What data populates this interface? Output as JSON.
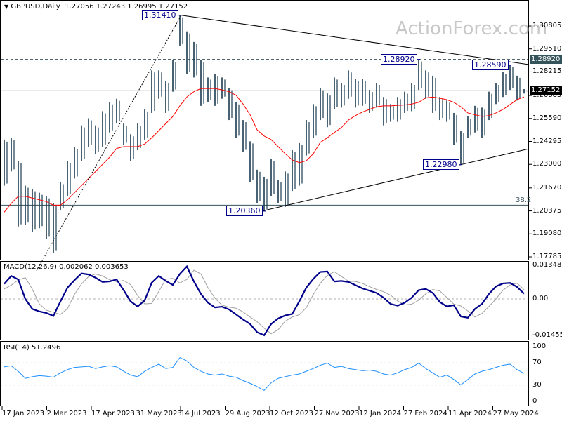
{
  "header": {
    "symbol": "GBPUSD,Daily",
    "ohlc": "1.27056 1.27243 1.26995 1.27152"
  },
  "watermark": "ActionForex.com",
  "colors": {
    "bars": "#1b3b50",
    "ma": "#ff0000",
    "macd": "#00008b",
    "signal": "#a0a0a0",
    "rsi": "#1e90ff",
    "current_tag": "#000000",
    "level_tag": "#35535a"
  },
  "chart_data": [
    {
      "type": "ohlc-bar",
      "timeframe": "Daily",
      "ylim": [
        1.17785,
        1.3141
      ],
      "y_ticks": [
        "1.30805",
        "1.29510",
        "1.28215",
        "1.26885",
        "1.25590",
        "1.24295",
        "1.23000",
        "1.21670",
        "1.20375",
        "1.19080",
        "1.17785"
      ],
      "x_ticks": [
        "17 Jan 2023",
        "2 Mar 2023",
        "17 Apr 2023",
        "31 May 2023",
        "14 Jul 2023",
        "29 Aug 2023",
        "12 Oct 2023",
        "27 Nov 2023",
        "12 Jan 2024",
        "27 Feb 2024",
        "11 Apr 2024",
        "27 May 2024"
      ],
      "bars_high_low": [
        [
          1.244,
          1.218
        ],
        [
          1.245,
          1.226
        ],
        [
          1.232,
          1.195
        ],
        [
          1.218,
          1.196
        ],
        [
          1.216,
          1.192
        ],
        [
          1.214,
          1.194
        ],
        [
          1.212,
          1.188
        ],
        [
          1.208,
          1.18
        ],
        [
          1.22,
          1.204
        ],
        [
          1.232,
          1.212
        ],
        [
          1.24,
          1.222
        ],
        [
          1.252,
          1.232
        ],
        [
          1.256,
          1.24
        ],
        [
          1.252,
          1.236
        ],
        [
          1.26,
          1.24
        ],
        [
          1.265,
          1.248
        ],
        [
          1.267,
          1.253
        ],
        [
          1.253,
          1.241
        ],
        [
          1.247,
          1.232
        ],
        [
          1.253,
          1.238
        ],
        [
          1.261,
          1.244
        ],
        [
          1.283,
          1.259
        ],
        [
          1.283,
          1.267
        ],
        [
          1.277,
          1.259
        ],
        [
          1.289,
          1.271
        ],
        [
          1.3141,
          1.297
        ],
        [
          1.305,
          1.281
        ],
        [
          1.299,
          1.279
        ],
        [
          1.289,
          1.263
        ],
        [
          1.279,
          1.265
        ],
        [
          1.281,
          1.263
        ],
        [
          1.279,
          1.267
        ],
        [
          1.273,
          1.255
        ],
        [
          1.265,
          1.245
        ],
        [
          1.255,
          1.237
        ],
        [
          1.243,
          1.22
        ],
        [
          1.227,
          1.208
        ],
        [
          1.223,
          1.2036
        ],
        [
          1.233,
          1.212
        ],
        [
          1.221,
          1.208
        ],
        [
          1.226,
          1.206
        ],
        [
          1.238,
          1.215
        ],
        [
          1.242,
          1.218
        ],
        [
          1.255,
          1.235
        ],
        [
          1.264,
          1.245
        ],
        [
          1.273,
          1.255
        ],
        [
          1.27,
          1.251
        ],
        [
          1.279,
          1.261
        ],
        [
          1.276,
          1.262
        ],
        [
          1.283,
          1.267
        ],
        [
          1.278,
          1.262
        ],
        [
          1.278,
          1.263
        ],
        [
          1.272,
          1.259
        ],
        [
          1.276,
          1.262
        ],
        [
          1.268,
          1.252
        ],
        [
          1.264,
          1.254
        ],
        [
          1.268,
          1.254
        ],
        [
          1.271,
          1.259
        ],
        [
          1.276,
          1.26
        ],
        [
          1.2892,
          1.272
        ],
        [
          1.283,
          1.267
        ],
        [
          1.28,
          1.259
        ],
        [
          1.268,
          1.255
        ],
        [
          1.266,
          1.254
        ],
        [
          1.259,
          1.241
        ],
        [
          1.249,
          1.2298
        ],
        [
          1.257,
          1.245
        ],
        [
          1.263,
          1.248
        ],
        [
          1.262,
          1.245
        ],
        [
          1.271,
          1.255
        ],
        [
          1.276,
          1.264
        ],
        [
          1.282,
          1.268
        ],
        [
          1.2859,
          1.272
        ],
        [
          1.28,
          1.266
        ],
        [
          1.27243,
          1.26995
        ]
      ],
      "moving_average": [
        1.203,
        1.208,
        1.212,
        1.212,
        1.211,
        1.21,
        1.209,
        1.207,
        1.207,
        1.21,
        1.214,
        1.218,
        1.222,
        1.226,
        1.23,
        1.234,
        1.239,
        1.24,
        1.24,
        1.24,
        1.2415,
        1.245,
        1.249,
        1.253,
        1.257,
        1.263,
        1.268,
        1.271,
        1.2728,
        1.2728,
        1.2728,
        1.272,
        1.271,
        1.269,
        1.264,
        1.258,
        1.2495,
        1.246,
        1.244,
        1.24,
        1.236,
        1.2325,
        1.231,
        1.232,
        1.236,
        1.2424,
        1.245,
        1.248,
        1.2507,
        1.255,
        1.2575,
        1.2595,
        1.261,
        1.2625,
        1.263,
        1.263,
        1.2633,
        1.2635,
        1.264,
        1.265,
        1.2675,
        1.268,
        1.2673,
        1.2665,
        1.265,
        1.2625,
        1.259,
        1.258,
        1.257,
        1.2575,
        1.259,
        1.261,
        1.2637,
        1.2665,
        1.268
      ],
      "swing_labels": [
        {
          "text": "1.31410",
          "price": 1.3141,
          "bar": 25
        },
        {
          "text": "1.28920",
          "price": 1.2892,
          "bar": 59
        },
        {
          "text": "1.28590",
          "price": 1.2859,
          "bar": 72
        },
        {
          "text": "1.22980",
          "price": 1.2298,
          "bar": 65
        },
        {
          "text": "1.20360",
          "price": 1.2036,
          "bar": 37
        }
      ],
      "trendlines": [
        {
          "style": "solid",
          "from": {
            "bar": 25.2,
            "price": 1.3141
          },
          "to": {
            "bar": 74.7,
            "price": 1.2863
          }
        },
        {
          "style": "solid",
          "from": {
            "bar": 36.6,
            "price": 1.2036
          },
          "to": {
            "bar": 74.7,
            "price": 1.2388
          }
        },
        {
          "style": "dotted",
          "from": {
            "bar": 4.6,
            "price": 1.17
          },
          "to": {
            "bar": 25.2,
            "price": 1.3141
          }
        }
      ],
      "horizontal_lines": [
        {
          "style": "dashed",
          "price": 1.2892,
          "tag": "1.28920"
        },
        {
          "style": "current",
          "price": 1.27152,
          "tag": "1.27152"
        },
        {
          "style": "fib",
          "price": 1.207,
          "label": "38.2"
        }
      ]
    },
    {
      "type": "line",
      "title": "MACD(12,26,9) 0.002062 0.003653",
      "y_ticks": [
        "0.013489",
        "0.00",
        "-0.014554"
      ],
      "ylim": [
        -0.014554,
        0.013489
      ],
      "macd": [
        0.006,
        0.0092,
        0.0078,
        0.0,
        -0.004,
        -0.005,
        -0.0056,
        -0.0068,
        -0.001,
        0.0045,
        0.0075,
        0.0102,
        0.0098,
        0.0085,
        0.0068,
        0.007,
        0.0078,
        0.0035,
        -0.001,
        -0.003,
        -0.0006,
        0.0065,
        0.0092,
        0.0072,
        0.0056,
        0.01,
        0.013,
        0.007,
        0.002,
        -0.0015,
        -0.0034,
        -0.0031,
        -0.0042,
        -0.0062,
        -0.0082,
        -0.01,
        -0.0133,
        -0.0145,
        -0.01,
        -0.0078,
        -0.0066,
        -0.006,
        -0.001,
        0.0045,
        0.008,
        0.0108,
        0.011,
        0.007,
        0.0072,
        0.0068,
        0.0055,
        0.0042,
        0.0033,
        0.0024,
        0.0005,
        -0.002,
        -0.0027,
        -0.0015,
        0.0005,
        0.0035,
        0.004,
        0.0024,
        -0.0012,
        -0.003,
        -0.0025,
        -0.007,
        -0.0075,
        -0.004,
        -0.002,
        0.002,
        0.005,
        0.0062,
        0.0064,
        0.0048,
        0.0021
      ],
      "signal": [
        0.004,
        0.0055,
        0.0076,
        0.0085,
        0.0039,
        -0.002,
        -0.0045,
        -0.0053,
        -0.0062,
        -0.0039,
        0.0018,
        0.006,
        0.0089,
        0.01,
        0.0092,
        0.0077,
        0.0069,
        0.0074,
        0.0057,
        0.0013,
        -0.002,
        -0.0018,
        0.003,
        0.0079,
        0.0082,
        0.0064,
        0.0078,
        0.0115,
        0.01,
        0.0045,
        0.0003,
        -0.0025,
        -0.0033,
        -0.0037,
        -0.0052,
        -0.0072,
        -0.0091,
        -0.0117,
        -0.0139,
        -0.0123,
        -0.0089,
        -0.0072,
        -0.0063,
        -0.0035,
        0.0018,
        0.0063,
        0.0094,
        0.0109,
        0.009,
        0.0071,
        0.007,
        0.0062,
        0.0049,
        0.0038,
        0.0029,
        0.0015,
        -0.0008,
        -0.0024,
        -0.0021,
        -0.0005,
        0.002,
        0.0038,
        0.0032,
        0.0006,
        -0.0021,
        -0.0028,
        -0.0048,
        -0.0072,
        -0.0058,
        -0.003,
        0.0,
        0.0035,
        0.0056,
        0.0063,
        0.0037
      ]
    },
    {
      "type": "line",
      "title": "RSI(14) 51.2496",
      "y_ticks": [
        "100",
        "70",
        "30",
        "0"
      ],
      "ylim": [
        0,
        100
      ],
      "levels": [
        70,
        30
      ],
      "values": [
        63,
        65,
        55,
        42,
        45,
        47,
        46,
        44,
        52,
        58,
        62,
        63,
        64,
        60,
        63,
        65,
        63,
        55,
        48,
        45,
        55,
        62,
        68,
        60,
        62,
        80,
        74,
        62,
        55,
        50,
        48,
        50,
        46,
        44,
        38,
        33,
        27,
        20,
        34,
        42,
        45,
        48,
        50,
        55,
        60,
        66,
        70,
        62,
        64,
        60,
        58,
        56,
        57,
        55,
        50,
        48,
        52,
        58,
        62,
        70,
        60,
        52,
        44,
        48,
        40,
        30,
        40,
        50,
        55,
        58,
        62,
        66,
        68,
        58,
        51.25
      ]
    }
  ]
}
